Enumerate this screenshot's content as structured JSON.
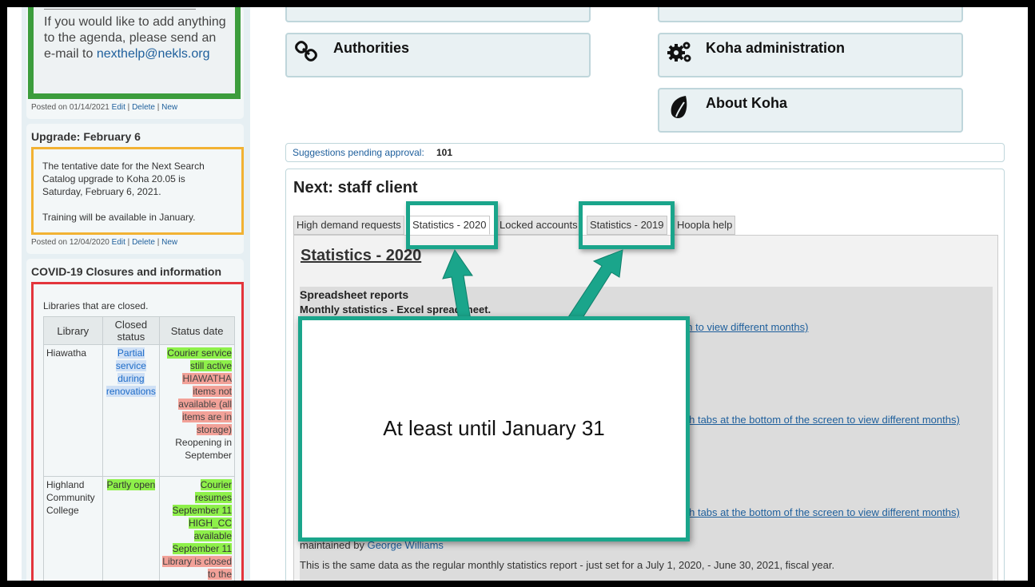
{
  "left": {
    "news1": {
      "text": "If you would like to add anything to the agenda, please send an e-mail to",
      "email": "nexthelp@nekls.org",
      "posted": "Posted on 01/14/2021"
    },
    "news2": {
      "title": "Upgrade: February 6",
      "body1": "The tentative date for the Next Search Catalog upgrade to Koha 20.05 is Saturday, February 6, 2021.",
      "body2": "Training will be available in January.",
      "posted": "Posted on 12/04/2020"
    },
    "news3": {
      "title": "COVID-19 Closures and information",
      "intro": "Libraries that are closed.",
      "headers": [
        "Library",
        "Closed status",
        "Status date"
      ],
      "rows": [
        {
          "library": "Hiawatha",
          "closed": "Partial service during renovations",
          "status_green": "Courier service still active",
          "status_red": "HIAWATHA items not available (all items are in storage)",
          "status_plain": "Reopening in September"
        },
        {
          "library": "Highland Community College",
          "closed": "Partly open",
          "status_green": "Courier resumes September 11 HIGH_CC available September 11",
          "status_red": "Library is closed to the",
          "status_plain": ""
        }
      ]
    },
    "actions": {
      "edit": "Edit",
      "delete": "Delete",
      "new": "New",
      "sep": "|"
    }
  },
  "modules": {
    "authorities": "Authorities",
    "koha_admin": "Koha administration",
    "about": "About Koha"
  },
  "suggestions": {
    "label": "Suggestions pending approval:",
    "count": "101"
  },
  "panel": {
    "title": "Next: staff client",
    "tabs": [
      "High demand requests",
      "Statistics - 2020",
      "Locked accounts",
      "Statistics - 2019",
      "Hoopla help"
    ],
    "content": {
      "title": "Statistics - 2020",
      "heading": "Spreadsheet reports",
      "sub": "Monthly statistics - Excel spreadsheet.",
      "link1": "en to view different months)",
      "link2": "tch tabs at the bottom of the screen to view different months)",
      "link3": "tch tabs at the bottom of the screen to view different months)",
      "maintained_prefix": "maintained by",
      "maintained_name": "George Williams",
      "note": "This is the same data as the regular monthly statistics report - just set for a July 1, 2020, - June 30, 2021, fiscal year."
    }
  },
  "callout": {
    "text": "At least until January 31"
  },
  "colors": {
    "highlight": "#1aa58b",
    "green_border": "#3c9d3c",
    "orange_border": "#f2b233",
    "red_border": "#e3353c"
  }
}
